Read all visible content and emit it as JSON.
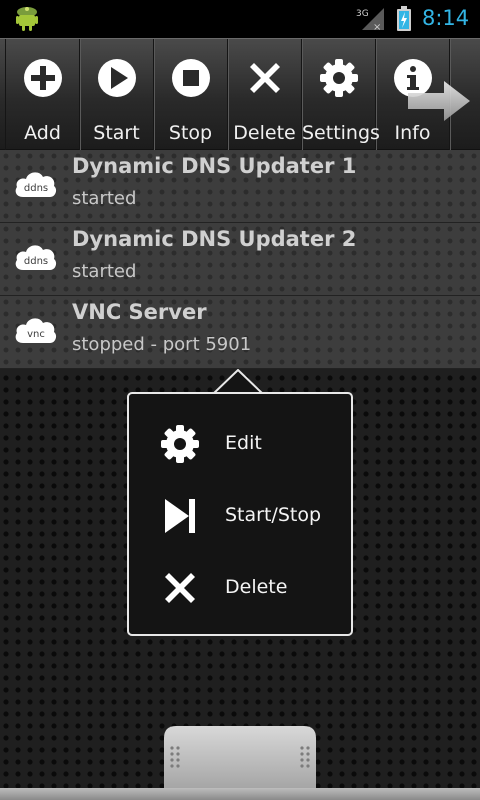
{
  "status_bar": {
    "network": "3G",
    "time": "8:14",
    "app_icon": "android-icon",
    "time_color": "#33b5e5"
  },
  "toolbar": {
    "buttons": [
      {
        "label": "Add",
        "icon": "add-icon"
      },
      {
        "label": "Start",
        "icon": "play-icon"
      },
      {
        "label": "Stop",
        "icon": "stop-icon"
      },
      {
        "label": "Delete",
        "icon": "delete-icon"
      },
      {
        "label": "Settings",
        "icon": "gear-icon"
      },
      {
        "label": "Info",
        "icon": "info-icon"
      }
    ],
    "more_icon": "arrow-right-icon"
  },
  "services": [
    {
      "name": "Dynamic DNS Updater 1",
      "status": "started",
      "icon_text": "ddns"
    },
    {
      "name": "Dynamic DNS Updater 2",
      "status": "started",
      "icon_text": "ddns"
    },
    {
      "name": "VNC Server",
      "status": "stopped - port 5901",
      "icon_text": "vnc"
    }
  ],
  "context_menu": {
    "items": [
      {
        "label": "Edit",
        "icon": "gear-icon"
      },
      {
        "label": "Start/Stop",
        "icon": "skip-next-icon"
      },
      {
        "label": "Delete",
        "icon": "delete-icon"
      }
    ]
  }
}
